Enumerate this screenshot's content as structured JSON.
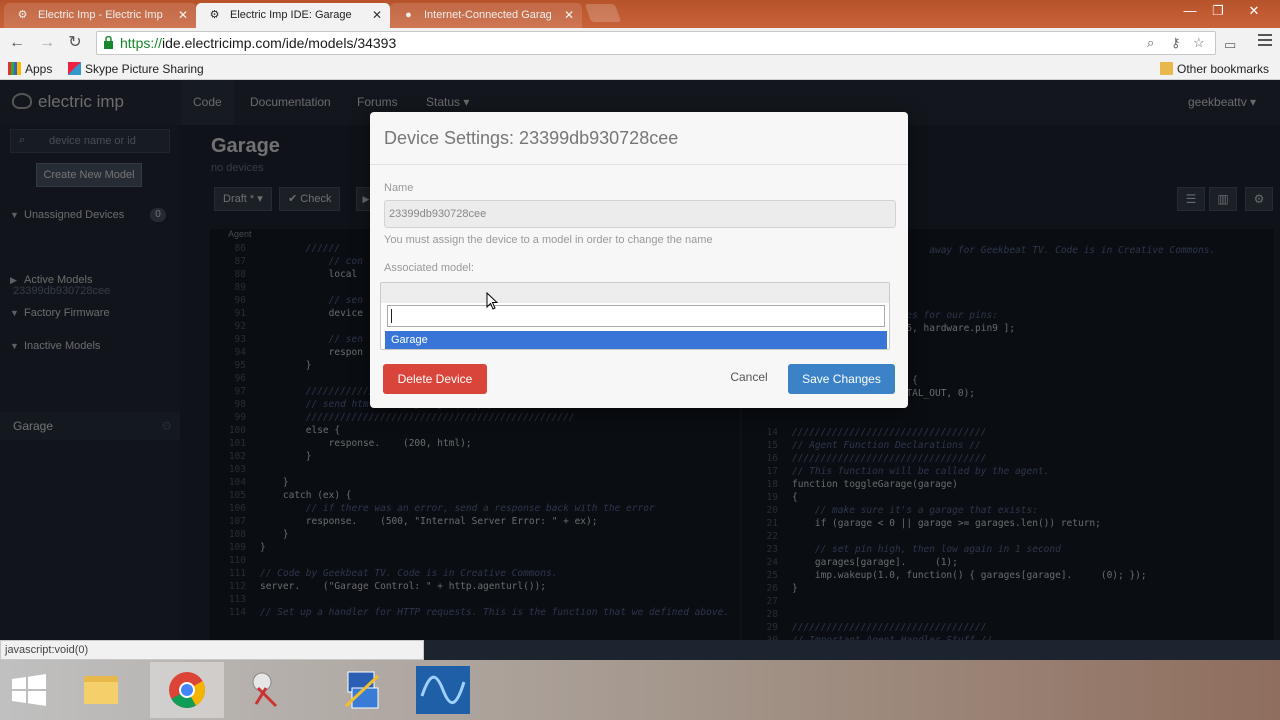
{
  "browser": {
    "tabs": [
      {
        "title": "Electric Imp - Electric Imp",
        "active": false
      },
      {
        "title": "Electric Imp IDE: Garage",
        "active": true
      },
      {
        "title": "Internet-Connected Garag",
        "active": false
      }
    ],
    "url_scheme": "https://",
    "url_rest": "ide.electricimp.com/ide/models/34393",
    "bookmarks": {
      "apps": "Apps",
      "skype": "Skype Picture Sharing",
      "other": "Other bookmarks"
    },
    "status_text": "javascript:void(0)"
  },
  "app": {
    "logo": "electric imp",
    "nav": {
      "code": "Code",
      "documentation": "Documentation",
      "forums": "Forums",
      "status": "Status ▾",
      "user": "geekbeattv ▾"
    },
    "sidebar": {
      "search_placeholder": "device name or id",
      "create_button": "Create New Model",
      "unassigned_label": "Unassigned Devices",
      "unassigned_count": "0",
      "unassigned_device": "23399db930728cee",
      "active_models": "Active Models",
      "factory_firmware": "Factory Firmware",
      "inactive_models": "Inactive Models",
      "garage": "Garage"
    },
    "main": {
      "title": "Garage",
      "subtitle": "no devices",
      "draft": "Draft * ▾",
      "check": "✔ Check",
      "agent_label": "Agent"
    },
    "editor_left": [
      {
        "n": "86",
        "c": "",
        "k": "cm",
        "t": "        //////"
      },
      {
        "n": "87",
        "c": "",
        "k": "cm",
        "t": "            // con"
      },
      {
        "n": "88",
        "c": "",
        "k": "tx",
        "t": "            local"
      },
      {
        "n": "89",
        "c": "",
        "k": "tx",
        "t": ""
      },
      {
        "n": "90",
        "c": "",
        "k": "cm",
        "t": "            // sen"
      },
      {
        "n": "91",
        "c": "",
        "k": "tx",
        "t": "            device"
      },
      {
        "n": "92",
        "c": "",
        "k": "tx",
        "t": ""
      },
      {
        "n": "93",
        "c": "",
        "k": "cm",
        "t": "            // sen"
      },
      {
        "n": "94",
        "c": "",
        "k": "tx",
        "t": "            respon"
      },
      {
        "n": "95",
        "c": "",
        "k": "tx",
        "t": "        }"
      },
      {
        "n": "96",
        "c": "",
        "k": "tx",
        "t": ""
      },
      {
        "n": "97",
        "c": "",
        "k": "cm",
        "t": "        ///////////////////////////////////////////////"
      },
      {
        "n": "98",
        "c": "",
        "k": "cm",
        "t": "        // send html if no garage query parameter //"
      },
      {
        "n": "99",
        "c": "",
        "k": "cm",
        "t": "        ///////////////////////////////////////////////"
      },
      {
        "n": "100",
        "c": "",
        "k": "tx",
        "t": "        else {"
      },
      {
        "n": "101",
        "c": "",
        "k": "tx",
        "t": "            response.    (200, html);"
      },
      {
        "n": "102",
        "c": "",
        "k": "tx",
        "t": "        }"
      },
      {
        "n": "103",
        "c": "",
        "k": "tx",
        "t": ""
      },
      {
        "n": "104",
        "c": "",
        "k": "tx",
        "t": "    }"
      },
      {
        "n": "105",
        "c": "",
        "k": "tx",
        "t": "    catch (ex) {"
      },
      {
        "n": "106",
        "c": "",
        "k": "cm",
        "t": "        // if there was an error, send a response back with the error"
      },
      {
        "n": "107",
        "c": "",
        "k": "tx",
        "t": "        response.    (500, \"Internal Server Error: \" + ex);"
      },
      {
        "n": "108",
        "c": "",
        "k": "tx",
        "t": "    }"
      },
      {
        "n": "109",
        "c": "",
        "k": "tx",
        "t": "}"
      },
      {
        "n": "110",
        "c": "",
        "k": "tx",
        "t": ""
      },
      {
        "n": "111",
        "c": "",
        "k": "cm",
        "t": "// Code by Geekbeat TV. Code is in Creative Commons."
      },
      {
        "n": "112",
        "c": "",
        "k": "tx",
        "t": "server.    (\"Garage Control: \" + http.agenturl());"
      },
      {
        "n": "113",
        "c": "",
        "k": "tx",
        "t": ""
      },
      {
        "n": "114",
        "c": "",
        "k": "cm",
        "t": "// Set up a handler for HTTP requests. This is the function that we defined above."
      }
    ],
    "editor_right": [
      {
        "n": "",
        "k": "cm",
        "t": "                        away for Geekbeat TV. Code is in Creative Commons."
      },
      {
        "n": "",
        "k": "tx",
        "t": ""
      },
      {
        "n": "",
        "k": "tx",
        "t": ""
      },
      {
        "n": "",
        "k": "tx",
        "t": ""
      },
      {
        "n": "",
        "k": "tx",
        "t": ""
      },
      {
        "n": "",
        "k": "cm",
        "t": "               riables for our pins:"
      },
      {
        "n": "",
        "k": "tx",
        "t": "               e.pin5, hardware.pin9 ];"
      },
      {
        "n": "",
        "k": "tx",
        "t": ""
      },
      {
        "n": "",
        "k": "tx",
        "t": ""
      },
      {
        "n": "",
        "k": "tx",
        "t": ""
      },
      {
        "n": "",
        "k": "tx",
        "t": "               ages) {"
      },
      {
        "n": "",
        "k": "tx",
        "t": "               (DIGITAL_OUT, 0);"
      },
      {
        "n": "",
        "k": "tx",
        "t": ""
      },
      {
        "n": "",
        "k": "tx",
        "t": ""
      },
      {
        "n": "14",
        "k": "cm",
        "t": "//////////////////////////////////"
      },
      {
        "n": "15",
        "k": "cm",
        "t": "// Agent Function Declarations //"
      },
      {
        "n": "16",
        "k": "cm",
        "t": "//////////////////////////////////"
      },
      {
        "n": "17",
        "k": "cm",
        "t": "// This function will be called by the agent."
      },
      {
        "n": "18",
        "k": "tx",
        "t": "function toggleGarage(garage)"
      },
      {
        "n": "19",
        "k": "tx",
        "t": "{"
      },
      {
        "n": "20",
        "k": "cm",
        "t": "    // make sure it's a garage that exists:"
      },
      {
        "n": "21",
        "k": "tx",
        "t": "    if (garage < 0 || garage >= garages.len()) return;"
      },
      {
        "n": "22",
        "k": "tx",
        "t": ""
      },
      {
        "n": "23",
        "k": "cm",
        "t": "    // set pin high, then low again in 1 second"
      },
      {
        "n": "24",
        "k": "tx",
        "t": "    garages[garage].     (1);"
      },
      {
        "n": "25",
        "k": "tx",
        "t": "    imp.wakeup(1.0, function() { garages[garage].     (0); });"
      },
      {
        "n": "26",
        "k": "tx",
        "t": "}"
      },
      {
        "n": "27",
        "k": "tx",
        "t": ""
      },
      {
        "n": "28",
        "k": "tx",
        "t": ""
      },
      {
        "n": "29",
        "k": "cm",
        "t": "//////////////////////////////////"
      },
      {
        "n": "30",
        "k": "cm",
        "t": "// Important Agent Handler Stuff //"
      }
    ]
  },
  "modal": {
    "title": "Device Settings: 23399db930728cee",
    "name_label": "Name",
    "name_value": "23399db930728cee",
    "name_help": "You must assign the device to a model in order to change the name",
    "assoc_label": "Associated model:",
    "option_selected": "Garage",
    "delete_button": "Delete Device",
    "cancel_button": "Cancel",
    "save_button": "Save Changes"
  }
}
